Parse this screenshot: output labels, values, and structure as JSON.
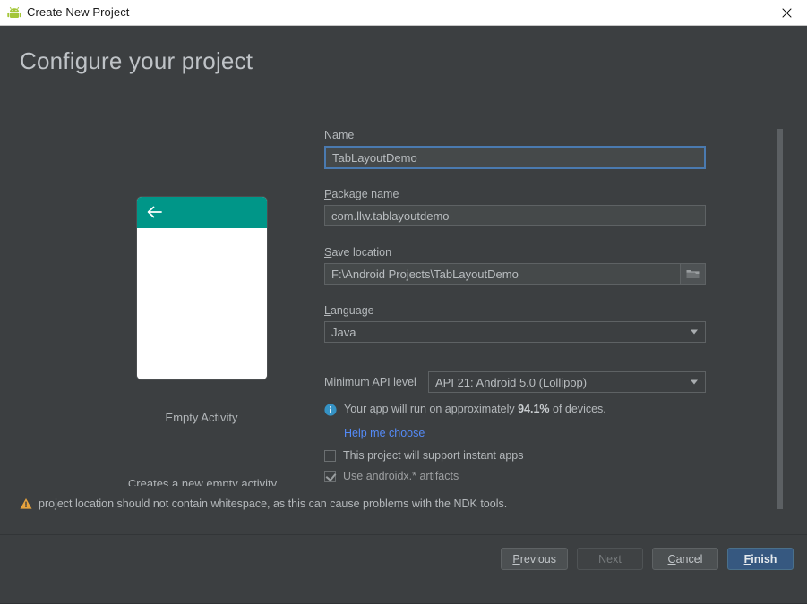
{
  "window": {
    "title": "Create New Project",
    "app_icon": "android-robot-icon",
    "close_icon": "close-icon",
    "titlebar_bg": "#ffffff",
    "dialog_bg": "#3c3f41"
  },
  "page": {
    "heading": "Configure your project"
  },
  "preview": {
    "appbar_icon": "back-arrow-icon",
    "appbar_color": "#009688",
    "body_color": "#ffffff",
    "template_name": "Empty Activity",
    "template_description": "Creates a new empty activity"
  },
  "form": {
    "name": {
      "label": "Name",
      "mnemonic": "N",
      "label_rest": "ame",
      "value": "TabLayoutDemo",
      "focused": true,
      "focus_color": "#4a7ab0"
    },
    "package_name": {
      "label": "Package name",
      "mnemonic": "P",
      "label_rest": "ackage name",
      "value": "com.llw.tablayoutdemo"
    },
    "save_location": {
      "label": "Save location",
      "mnemonic": "S",
      "label_rest": "ave location",
      "value": "F:\\Android Projects\\TabLayoutDemo",
      "browse_icon": "folder-icon"
    },
    "language": {
      "label": "Language",
      "mnemonic": "L",
      "label_rest": "anguage",
      "value": "Java",
      "arrow_icon": "chevron-down-icon"
    },
    "min_api": {
      "label": "Minimum API level",
      "value": "API 21: Android 5.0 (Lollipop)",
      "arrow_icon": "chevron-down-icon"
    },
    "device_info": {
      "icon": "info-icon",
      "icon_color": "#3592c4",
      "text_before": "Your app will run on approximately ",
      "percent": "94.1%",
      "text_after": " of devices."
    },
    "help_link": {
      "text": "Help me choose",
      "color": "#548af7"
    },
    "instant_apps": {
      "label": "This project will support instant apps",
      "checked": false
    },
    "androidx": {
      "label": "Use androidx.* artifacts",
      "checked": true
    }
  },
  "warning": {
    "icon": "warning-triangle-icon",
    "icon_color": "#e8a33d",
    "text": "project location should not contain whitespace, as this can cause problems with the NDK tools."
  },
  "footer": {
    "buttons": [
      {
        "id": "previous",
        "mnemonic": "P",
        "label_rest": "revious",
        "full_label": "Previous",
        "state": "enabled"
      },
      {
        "id": "next",
        "mnemonic": "",
        "label_rest": "Next",
        "full_label": "Next",
        "state": "disabled"
      },
      {
        "id": "cancel",
        "mnemonic": "C",
        "label_rest": "ancel",
        "full_label": "Cancel",
        "state": "enabled"
      },
      {
        "id": "finish",
        "mnemonic": "F",
        "label_rest": "inish",
        "full_label": "Finish",
        "state": "default"
      }
    ],
    "primary_color": "#365880"
  },
  "scrollbar": {
    "orientation": "vertical",
    "thumb_color": "#5c6063"
  }
}
